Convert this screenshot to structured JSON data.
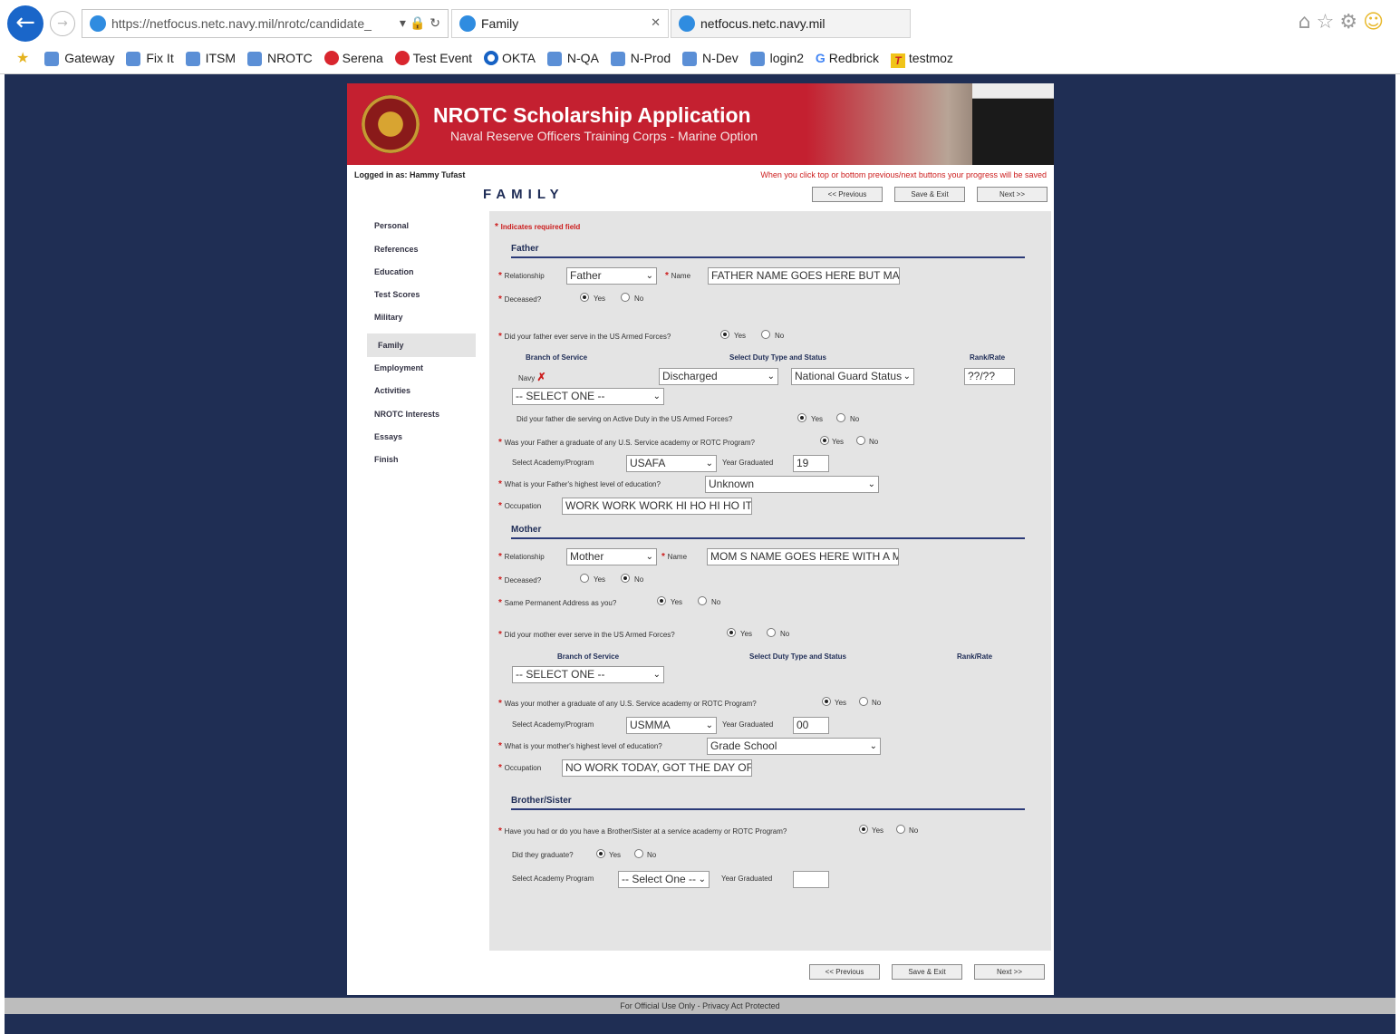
{
  "browser": {
    "address": "https://netfocus.netc.navy.mil/nrotc/candidate_",
    "tab_active": "Family",
    "tab_inactive": "netfocus.netc.navy.mil",
    "favorites": [
      "Gateway",
      "Fix It",
      "ITSM",
      "NROTC",
      "Serena",
      "Test Event",
      "OKTA",
      "N-QA",
      "N-Prod",
      "N-Dev",
      "login2",
      "Redbrick",
      "testmoz"
    ]
  },
  "banner": {
    "title": "NROTC Scholarship Application",
    "subtitle": "Naval Reserve Officers Training Corps - Marine Option"
  },
  "header": {
    "logged_in": "Logged in as: Hammy Tufast",
    "warning": "When you click top or bottom previous/next buttons your progress will be saved",
    "page_title": "FAMILY"
  },
  "buttons": {
    "previous": "<< Previous",
    "save": "Save & Exit",
    "next": "Next >>"
  },
  "nav": [
    "Personal",
    "References",
    "Education",
    "Test Scores",
    "Military",
    "Family",
    "Employment",
    "Activities",
    "NROTC Interests",
    "Essays",
    "Finish"
  ],
  "form": {
    "required_note": "Indicates required field",
    "father": {
      "section": "Father",
      "relationship_label": "Relationship",
      "relationship": "Father",
      "name_label": "Name",
      "name": "FATHER NAME GOES HERE BUT MA",
      "deceased_label": "Deceased?",
      "served_q": "Did your father ever serve in the US Armed Forces?",
      "col_branch": "Branch of Service",
      "col_duty": "Select Duty Type and Status",
      "col_rank": "Rank/Rate",
      "branch": "Navy",
      "duty": "Discharged",
      "status": "National Guard Status",
      "rank": "??/??",
      "select_one": "-- SELECT ONE --",
      "died_q": "Did your father die serving on Active Duty in the US Armed Forces?",
      "grad_q": "Was your Father a graduate of any U.S. Service academy or ROTC Program?",
      "academy_label": "Select Academy/Program",
      "academy": "USAFA",
      "year_label": "Year Graduated",
      "year": "19",
      "edu_q": "What is your Father's highest level of education?",
      "edu": "Unknown",
      "occ_label": "Occupation",
      "occ": "WORK WORK WORK HI HO HI HO ITS"
    },
    "mother": {
      "section": "Mother",
      "relationship_label": "Relationship",
      "relationship": "Mother",
      "name_label": "Name",
      "name": "MOM S NAME GOES HERE WITH A M",
      "deceased_label": "Deceased?",
      "address_q": "Same Permanent Address as you?",
      "served_q": "Did your mother ever serve in the US Armed Forces?",
      "col_branch": "Branch of Service",
      "col_duty": "Select Duty Type and Status",
      "col_rank": "Rank/Rate",
      "select_one": "-- SELECT ONE --",
      "grad_q": "Was your mother a graduate of any U.S. Service academy or ROTC Program?",
      "academy_label": "Select Academy/Program",
      "academy": "USMMA",
      "year_label": "Year Graduated",
      "year": "00",
      "edu_q": "What is your mother's highest level of education?",
      "edu": "Grade School",
      "occ_label": "Occupation",
      "occ": "NO WORK TODAY, GOT THE DAY OF"
    },
    "sibling": {
      "section": "Brother/Sister",
      "had_q": "Have you had or do you have a Brother/Sister at a service academy or ROTC Program?",
      "grad_q": "Did they graduate?",
      "academy_label": "Select Academy Program",
      "academy": "-- Select One --",
      "year_label": "Year Graduated"
    },
    "yes": "Yes",
    "no": "No"
  },
  "footer": "For Official Use Only - Privacy Act Protected"
}
